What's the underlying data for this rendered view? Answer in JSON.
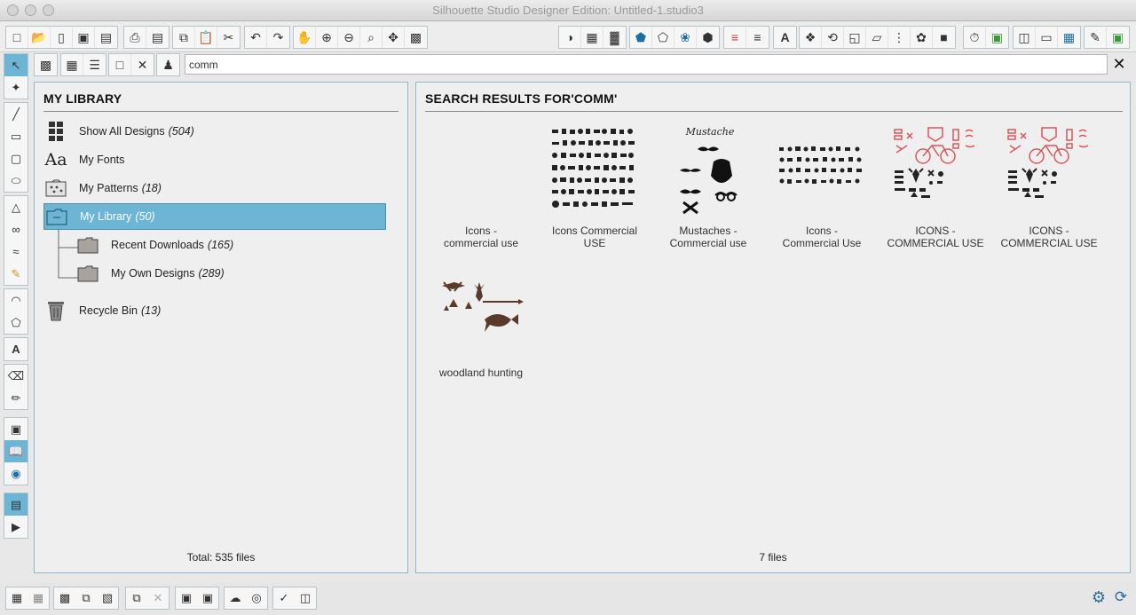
{
  "window": {
    "title": "Silhouette Studio Designer Edition: Untitled-1.studio3"
  },
  "search": {
    "query": "comm"
  },
  "library": {
    "heading": "MY LIBRARY",
    "items": [
      {
        "label": "Show All Designs",
        "count": "(504)",
        "icon": "grid-icon"
      },
      {
        "label": "My Fonts",
        "count": "",
        "icon": "font-icon"
      },
      {
        "label": "My Patterns",
        "count": "(18)",
        "icon": "pattern-icon"
      },
      {
        "label": "My Library",
        "count": "(50)",
        "icon": "folder-icon"
      },
      {
        "label": "Recent Downloads",
        "count": "(165)",
        "icon": "folder-icon"
      },
      {
        "label": "My Own Designs",
        "count": "(289)",
        "icon": "folder-icon"
      },
      {
        "label": "Recycle Bin",
        "count": "(13)",
        "icon": "trash-icon"
      }
    ],
    "font_icon_text": "Aa",
    "total": "Total: 535 files"
  },
  "results": {
    "heading": "SEARCH RESULTS FOR'COMM'",
    "items": [
      {
        "line1": "Icons -",
        "line2": "commercial use"
      },
      {
        "line1": "Icons Commercial",
        "line2": "USE"
      },
      {
        "line1": "Mustaches -",
        "line2": "Commercial use",
        "thumb_text": "Mustache"
      },
      {
        "line1": "Icons -",
        "line2": "Commercial Use"
      },
      {
        "line1": "ICONS -",
        "line2": "COMMERCIAL USE"
      },
      {
        "line1": "ICONS -",
        "line2": "COMMERCIAL USE"
      },
      {
        "line1": "woodland hunting",
        "line2": ""
      }
    ],
    "footer": "7 files"
  },
  "colors": {
    "accent": "#6cb5d4",
    "panel_border": "#8fb8cc",
    "brown": "#5a3a2a",
    "red": "#d9575b"
  }
}
